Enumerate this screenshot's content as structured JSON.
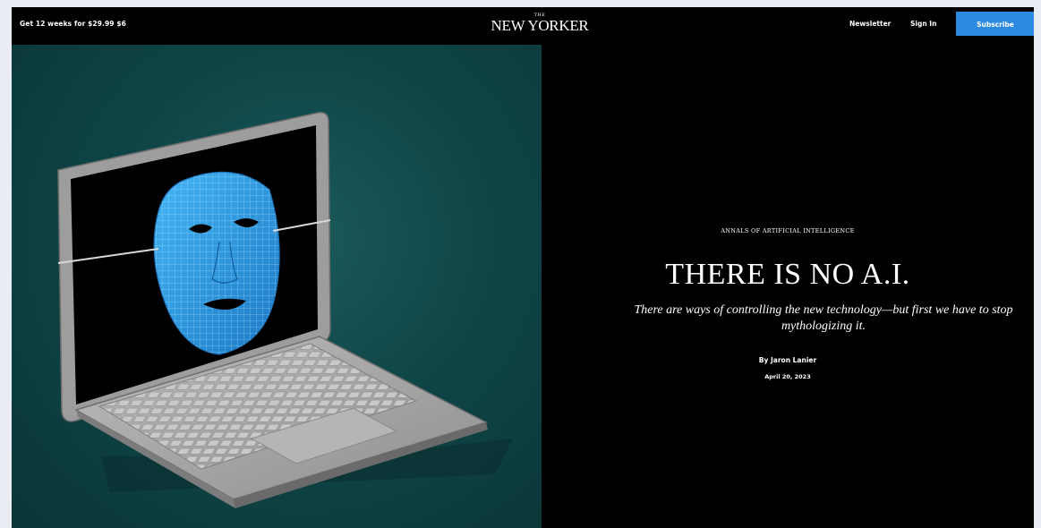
{
  "topbar": {
    "promo_text": "Get 12 weeks for $29.99 $6",
    "logo_small": "THE",
    "logo_text": "NEW YORKER",
    "newsletter_label": "Newsletter",
    "signin_label": "Sign In",
    "subscribe_label": "Subscribe",
    "subscribe_color": "#2c8ae0"
  },
  "article": {
    "rubric": "ANNALS OF ARTIFICIAL INTELLIGENCE",
    "headline": "THERE IS NO A.I.",
    "dek": "There are ways of controlling the new technology—but first we have to stop mythologizing it.",
    "byline_prefix": "By ",
    "author": "Jaron Lanier",
    "date": "April 20, 2023"
  },
  "hero": {
    "illustration": "laptop-with-wireframe-face-mask",
    "background_color": "#0f4547",
    "mask_color": "#2e9be6"
  }
}
